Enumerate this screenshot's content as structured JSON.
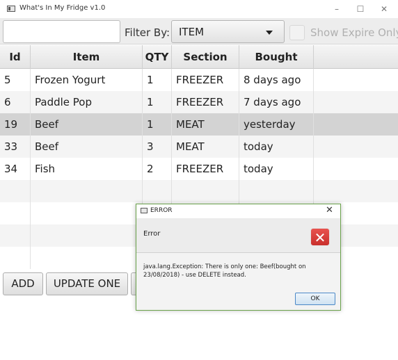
{
  "window": {
    "title": "What's In My Fridge v1.0",
    "controls": {
      "minimize": "–",
      "maximize": "☐",
      "close": "✕"
    }
  },
  "toolbar": {
    "filter_text_value": "",
    "filter_label": "Filter By:",
    "filter_selected": "ITEM",
    "expire_label": "Show Expire Only",
    "expire_checked": false
  },
  "table": {
    "columns": [
      "Id",
      "Item",
      "QTY",
      "Section",
      "Bought"
    ],
    "rows": [
      {
        "id": "5",
        "item": "Frozen Yogurt",
        "qty": "1",
        "section": "FREEZER",
        "bought": "8 days ago"
      },
      {
        "id": "6",
        "item": "Paddle Pop",
        "qty": "1",
        "section": "FREEZER",
        "bought": "7 days ago"
      },
      {
        "id": "19",
        "item": "Beef",
        "qty": "1",
        "section": "MEAT",
        "bought": "yesterday"
      },
      {
        "id": "33",
        "item": "Beef",
        "qty": "3",
        "section": "MEAT",
        "bought": "today"
      },
      {
        "id": "34",
        "item": "Fish",
        "qty": "2",
        "section": "FREEZER",
        "bought": "today"
      }
    ],
    "selected_row_index": 2
  },
  "buttons": {
    "add": "ADD",
    "update_one": "UPDATE ONE"
  },
  "dialog": {
    "title": "ERROR",
    "close": "✕",
    "header": "Error",
    "content": "java.lang.Exception: There is only one: Beef(bought on 23/08/2018) - use DELETE instead.",
    "ok": "OK",
    "error_icon": "✕"
  },
  "colors": {
    "selected_row": "#d3d3d3",
    "dialog_border": "#6aa24a",
    "error_icon": "#d9443f",
    "ok_button_border": "#4b88c7"
  }
}
